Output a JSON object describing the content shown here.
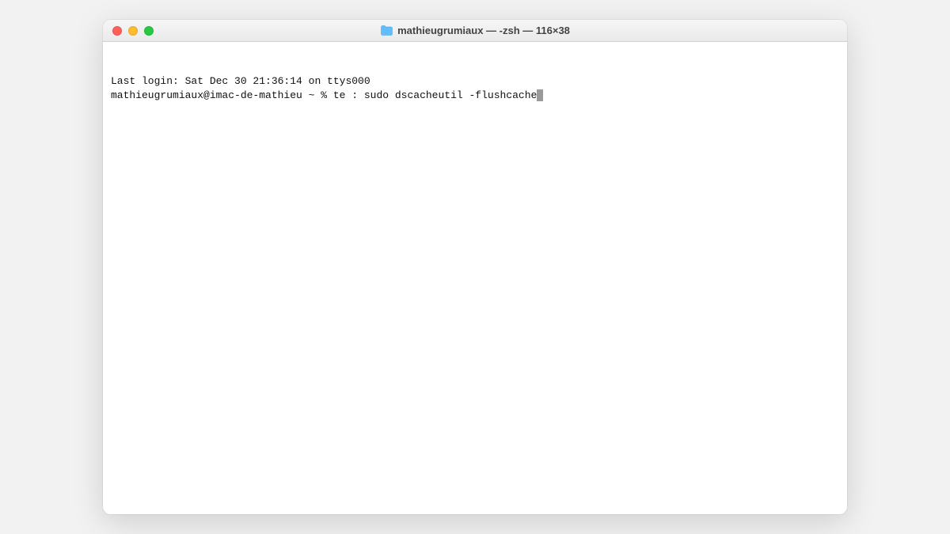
{
  "window": {
    "title": "mathieugrumiaux — -zsh — 116×38"
  },
  "terminal": {
    "last_login": "Last login: Sat Dec 30 21:36:14 on ttys000",
    "prompt": "mathieugrumiaux@imac-de-mathieu ~ % ",
    "command": "te : sudo dscacheutil -flushcache"
  }
}
